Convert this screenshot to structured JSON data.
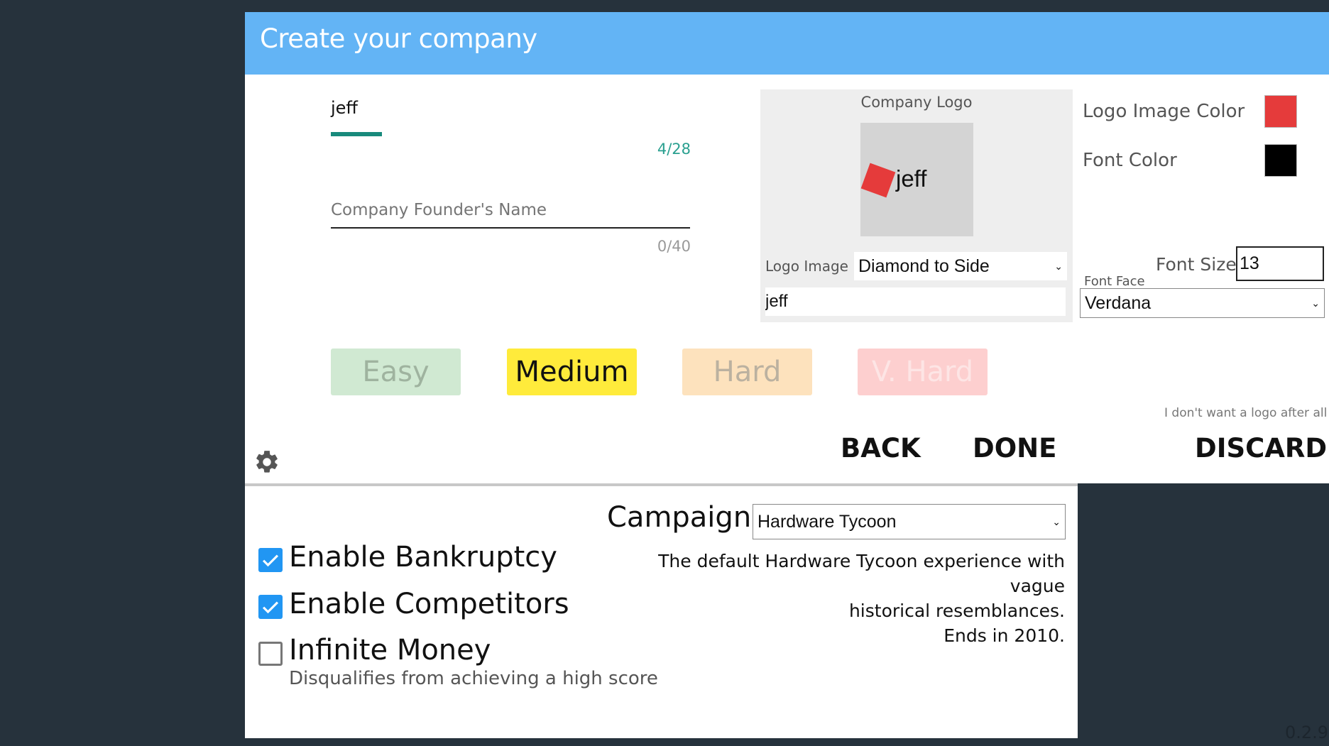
{
  "header": {
    "title": "Create your company"
  },
  "company_name": {
    "value": "jeff",
    "counter": "4/28"
  },
  "founder_name": {
    "placeholder": "Company Founder's Name",
    "value": "",
    "counter": "0/40"
  },
  "logo": {
    "title": "Company Logo",
    "preview_text": "jeff",
    "image_label": "Logo Image",
    "image_selected": "Diamond to Side",
    "text_value": "jeff",
    "image_color_label": "Logo Image Color",
    "image_color": "#e53b3b",
    "font_color_label": "Font Color",
    "font_color": "#000000",
    "font_size_label": "Font Size",
    "font_size": "13",
    "font_face_label": "Font Face",
    "font_face": "Verdana",
    "no_logo_link": "I don't want a logo after all"
  },
  "difficulty": {
    "options": [
      "Easy",
      "Medium",
      "Hard",
      "V. Hard"
    ],
    "selected": "Medium"
  },
  "actions": {
    "back": "BACK",
    "done": "DONE",
    "discard": "DISCARD"
  },
  "options": {
    "items": [
      {
        "label": "Enable Bankruptcy",
        "checked": true
      },
      {
        "label": "Enable Competitors",
        "checked": true
      },
      {
        "label": "Infinite Money",
        "checked": false,
        "note": "Disqualifies from achieving a high score"
      }
    ]
  },
  "campaign": {
    "label": "Campaign:",
    "selected": "Hardware Tycoon",
    "description_lines": [
      "The default Hardware Tycoon experience with vague",
      "historical resemblances.",
      "Ends in 2010."
    ]
  },
  "version": "0.2.9",
  "icons": {
    "gear": "gear-icon",
    "caret": "chevron-down-icon"
  }
}
